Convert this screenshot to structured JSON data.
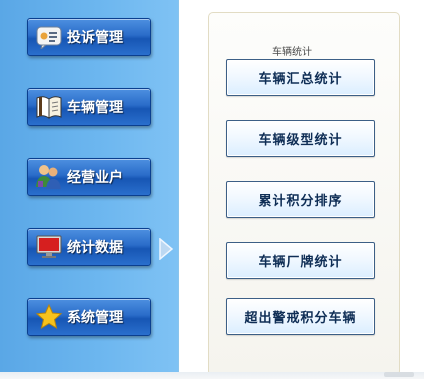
{
  "nav": {
    "items": [
      {
        "label": "投诉管理",
        "icon": "complaint-chat-icon"
      },
      {
        "label": "车辆管理",
        "icon": "open-book-icon"
      },
      {
        "label": "经营业户",
        "icon": "users-group-icon"
      },
      {
        "label": "统计数据",
        "icon": "monitor-icon"
      },
      {
        "label": "系统管理",
        "icon": "star-icon"
      }
    ],
    "active_index": 3
  },
  "panel": {
    "title": "车辆统计",
    "buttons": [
      {
        "label": "车辆汇总统计"
      },
      {
        "label": "车辆级型统计"
      },
      {
        "label": "累计积分排序"
      },
      {
        "label": "车辆厂牌统计"
      },
      {
        "label": "超出警戒积分车辆"
      }
    ]
  },
  "colors": {
    "nav_panel_bg": "#6cb6ef",
    "nav_button": "#2a6cc9",
    "stat_button_text": "#0e2d55",
    "stat_button_border": "#3c5f86"
  }
}
